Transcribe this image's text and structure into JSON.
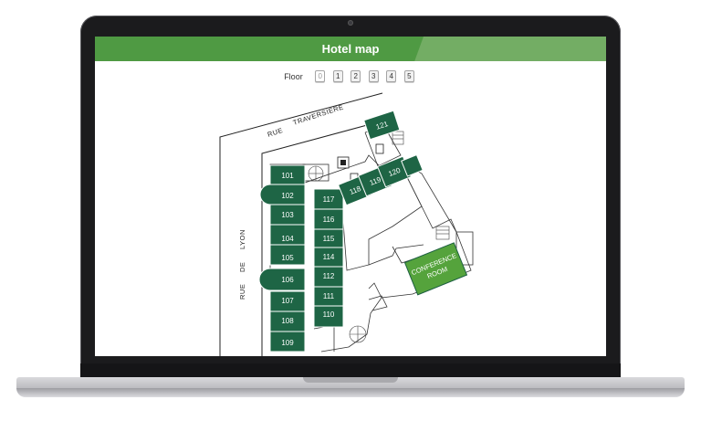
{
  "header": {
    "title": "Hotel map"
  },
  "floor_selector": {
    "label": "Floor",
    "floors": [
      "0",
      "1",
      "2",
      "3",
      "4",
      "5"
    ],
    "active": "0"
  },
  "map": {
    "streets": {
      "traversiere_rue": "RUE",
      "traversiere_name": "TRAVERSIÈRE",
      "lyon_rue": "RUE",
      "lyon_de": "DE",
      "lyon_name": "LYON"
    },
    "left_column": [
      "101",
      "102",
      "103",
      "104",
      "105",
      "106",
      "107",
      "108",
      "109"
    ],
    "right_column": [
      "117",
      "116",
      "115",
      "114",
      "112",
      "111",
      "110"
    ],
    "diagonal_rooms": [
      "118",
      "119",
      "120"
    ],
    "corner_room": "121",
    "conference_room": {
      "line1": "CONFERENCE",
      "line2": "ROOM"
    }
  },
  "colors": {
    "header": "#4f9a43",
    "room": "#1e6545",
    "conference": "#55a33c"
  }
}
